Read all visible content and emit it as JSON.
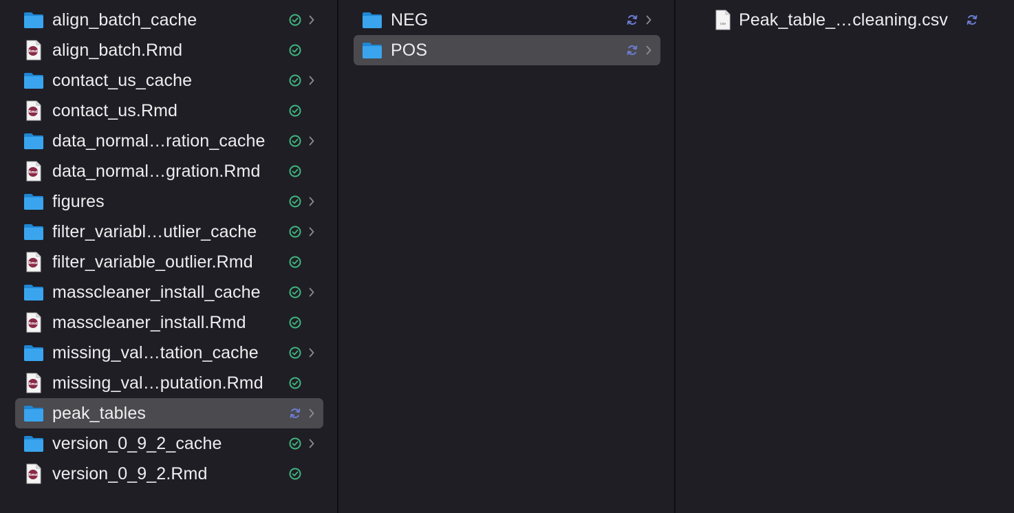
{
  "columns": [
    {
      "items": [
        {
          "name": "align_batch_cache",
          "type": "folder",
          "status": "synced",
          "has_children": true
        },
        {
          "name": "align_batch.Rmd",
          "type": "rmd",
          "status": "synced",
          "has_children": false
        },
        {
          "name": "contact_us_cache",
          "type": "folder",
          "status": "synced",
          "has_children": true
        },
        {
          "name": "contact_us.Rmd",
          "type": "rmd",
          "status": "synced",
          "has_children": false
        },
        {
          "name": "data_normal…ration_cache",
          "type": "folder",
          "status": "synced",
          "has_children": true
        },
        {
          "name": "data_normal…gration.Rmd",
          "type": "rmd",
          "status": "synced",
          "has_children": false
        },
        {
          "name": "figures",
          "type": "folder",
          "status": "synced",
          "has_children": true
        },
        {
          "name": "filter_variabl…utlier_cache",
          "type": "folder",
          "status": "synced",
          "has_children": true
        },
        {
          "name": "filter_variable_outlier.Rmd",
          "type": "rmd",
          "status": "synced",
          "has_children": false
        },
        {
          "name": "masscleaner_install_cache",
          "type": "folder",
          "status": "synced",
          "has_children": true
        },
        {
          "name": "masscleaner_install.Rmd",
          "type": "rmd",
          "status": "synced",
          "has_children": false
        },
        {
          "name": "missing_val…tation_cache",
          "type": "folder",
          "status": "synced",
          "has_children": true
        },
        {
          "name": "missing_val…putation.Rmd",
          "type": "rmd",
          "status": "synced",
          "has_children": false
        },
        {
          "name": "peak_tables",
          "type": "folder",
          "status": "syncing",
          "has_children": true,
          "selected": true
        },
        {
          "name": "version_0_9_2_cache",
          "type": "folder",
          "status": "synced",
          "has_children": true
        },
        {
          "name": "version_0_9_2.Rmd",
          "type": "rmd",
          "status": "synced",
          "has_children": false
        }
      ]
    },
    {
      "items": [
        {
          "name": "NEG",
          "type": "folder",
          "status": "syncing",
          "has_children": true
        },
        {
          "name": "POS",
          "type": "folder",
          "status": "syncing",
          "has_children": true,
          "selected": true
        }
      ]
    },
    {
      "items": [
        {
          "name": "Peak_table_…cleaning.csv",
          "type": "csv",
          "status": "syncing",
          "has_children": false
        }
      ]
    }
  ],
  "icons": {
    "folder": "folder-icon",
    "rmd": "rmd-file-icon",
    "csv": "csv-file-icon",
    "synced": "synced-check-icon",
    "syncing": "syncing-icon",
    "chevron": "chevron-right-icon"
  },
  "labels": {
    "rmd_badge": "Rmd",
    "csv_badge": "csv"
  },
  "colors": {
    "background": "#1f1e25",
    "selected_row": "#4a4a4f",
    "folder": "#3aa5ee",
    "synced": "#3fb67f",
    "syncing": "#6e7fd6",
    "rmd_badge": "#8a2a4a",
    "chevron": "#8c8c92"
  }
}
